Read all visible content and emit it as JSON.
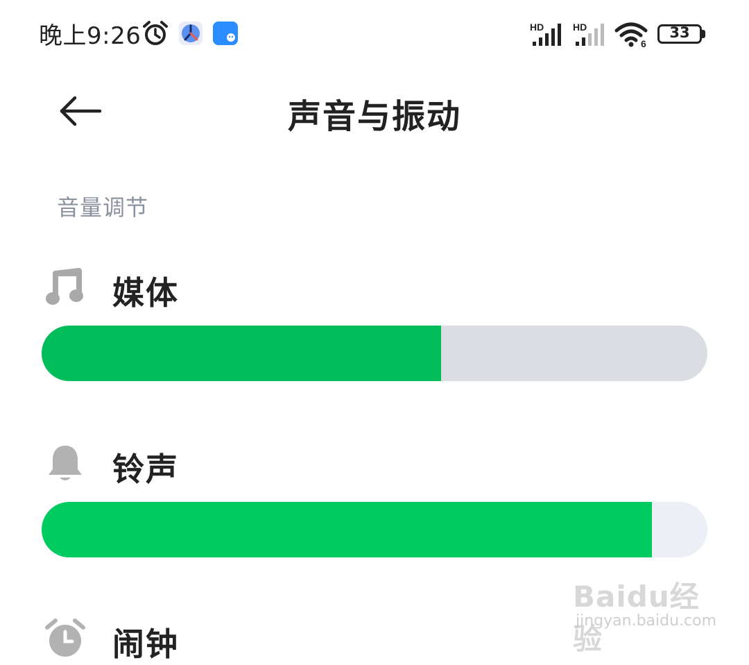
{
  "status_bar": {
    "time": "晚上9:26",
    "signal1_label": "HD",
    "signal2_label": "HD",
    "wifi_label": "6",
    "battery": "33"
  },
  "header": {
    "title": "声音与振动",
    "back_icon": "arrow-left-icon"
  },
  "section": {
    "title": "音量调节"
  },
  "volumes": [
    {
      "label": "媒体",
      "icon": "music-note-icon",
      "level": 0.6,
      "fill_color": "#00bd5a",
      "track_color": "#dadde1"
    },
    {
      "label": "铃声",
      "icon": "bell-icon",
      "level": 0.917,
      "fill_color": "#00cb60",
      "track_color": "#ecf0f6"
    },
    {
      "label": "闹钟",
      "icon": "alarm-clock-icon"
    }
  ],
  "watermark": {
    "logo": "Baidu经验",
    "url": "jingyan.baidu.com"
  }
}
